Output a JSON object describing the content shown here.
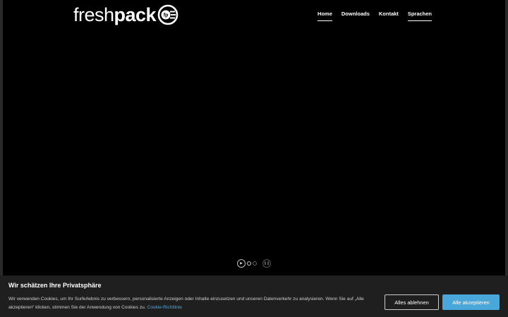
{
  "logo": {
    "text_light": "fresh",
    "text_bold": "pack",
    "mark_text": "fp"
  },
  "nav": {
    "items": [
      {
        "label": "Home"
      },
      {
        "label": "Downloads"
      },
      {
        "label": "Kontakt"
      },
      {
        "label": "Sprachen"
      }
    ]
  },
  "slider": {
    "play_symbol": "▶",
    "pause_symbol": "❚❚"
  },
  "cookie": {
    "title": "Wir schätzen Ihre Privatsphäre",
    "text": "Wir verwenden Cookies, um Ihr Surferlebnis zu verbessern, personalisierte Anzeigen oder Inhalte einzusetzen und unseren Datenverkehr zu analysieren. Wenn Sie auf „Alle akzeptieren“ klicken, stimmen Sie der Anwendung von Cookies zu.",
    "link": "Cookie-Richtlinie",
    "reject_label": "Alles ablehnen",
    "accept_label": "Alle akzeptieren",
    "accent_color": "#49a7d9"
  }
}
